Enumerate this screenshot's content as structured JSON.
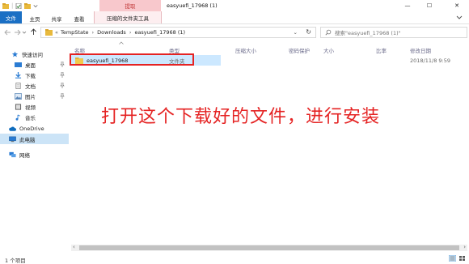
{
  "window": {
    "title": "easyuefi_17968 (1)",
    "context_tab_label": "提取",
    "minimize_glyph": "—",
    "maximize_glyph": "☐",
    "close_glyph": "✕"
  },
  "ribbon": {
    "tabs": [
      {
        "label": "文件",
        "active": true
      },
      {
        "label": "主页"
      },
      {
        "label": "共享"
      },
      {
        "label": "查看"
      },
      {
        "label": "压缩的文件夹工具",
        "context": true
      }
    ]
  },
  "address": {
    "path": [
      "TempState",
      "Downloads",
      "easyuefi_17968 (1)"
    ],
    "overflow": "«",
    "search_placeholder": "搜索\"easyuefi_17968 (1)\""
  },
  "nav": {
    "items": [
      {
        "label": "快速访问",
        "icon": "star-icon"
      },
      {
        "label": "桌面",
        "icon": "desktop-icon",
        "pinned": true
      },
      {
        "label": "下载",
        "icon": "download-icon",
        "pinned": true
      },
      {
        "label": "文档",
        "icon": "document-icon",
        "pinned": true
      },
      {
        "label": "图片",
        "icon": "picture-icon",
        "pinned": true
      },
      {
        "label": "视频",
        "icon": "video-icon"
      },
      {
        "label": "音乐",
        "icon": "music-icon"
      },
      {
        "label": "OneDrive",
        "icon": "cloud-icon"
      },
      {
        "label": "此电脑",
        "icon": "computer-icon",
        "selected": true
      },
      {
        "label": "网络",
        "icon": "network-icon"
      }
    ]
  },
  "columns": [
    "名称",
    "类型",
    "压缩大小",
    "密码保护",
    "大小",
    "比率",
    "修改日期"
  ],
  "files": [
    {
      "name": "easyuefi_17968",
      "type": "文件夹",
      "modified": "2018/11/8 9:59"
    }
  ],
  "annotation": "打开这个下载好的文件，进行安装",
  "status": {
    "item_count": "1 个项目"
  },
  "colors": {
    "accent": "#1a6fc4",
    "context_tab": "#f8c8cc",
    "highlight_border": "#e52323",
    "selection": "#cce8ff"
  }
}
